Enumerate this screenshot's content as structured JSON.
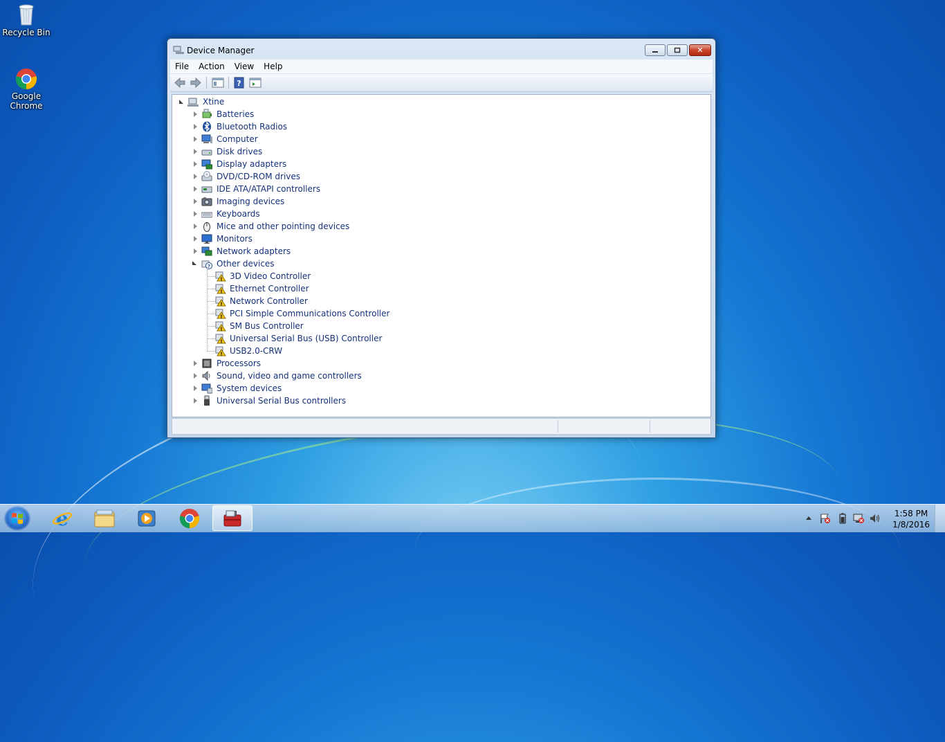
{
  "desktop": {
    "icons": [
      {
        "label": "Recycle Bin"
      },
      {
        "label": "Google Chrome"
      }
    ]
  },
  "window": {
    "title": "Device Manager",
    "menu": [
      "File",
      "Action",
      "View",
      "Help"
    ]
  },
  "tree": {
    "root": "Xtine",
    "categories": [
      {
        "label": "Batteries",
        "icon": "battery-icon",
        "expanded": false
      },
      {
        "label": "Bluetooth Radios",
        "icon": "bluetooth-icon",
        "expanded": false
      },
      {
        "label": "Computer",
        "icon": "computer-icon",
        "expanded": false
      },
      {
        "label": "Disk drives",
        "icon": "disk-drive-icon",
        "expanded": false
      },
      {
        "label": "Display adapters",
        "icon": "display-adapter-icon",
        "expanded": false
      },
      {
        "label": "DVD/CD-ROM drives",
        "icon": "dvd-drive-icon",
        "expanded": false
      },
      {
        "label": "IDE ATA/ATAPI controllers",
        "icon": "ide-controller-icon",
        "expanded": false
      },
      {
        "label": "Imaging devices",
        "icon": "camera-icon",
        "expanded": false
      },
      {
        "label": "Keyboards",
        "icon": "keyboard-icon",
        "expanded": false
      },
      {
        "label": "Mice and other pointing devices",
        "icon": "mouse-icon",
        "expanded": false
      },
      {
        "label": "Monitors",
        "icon": "monitor-icon",
        "expanded": false
      },
      {
        "label": "Network adapters",
        "icon": "network-adapter-icon",
        "expanded": false
      },
      {
        "label": "Other devices",
        "icon": "unknown-device-icon",
        "expanded": true,
        "children": [
          "3D Video Controller",
          "Ethernet Controller",
          "Network Controller",
          "PCI Simple Communications Controller",
          "SM Bus Controller",
          "Universal Serial Bus (USB) Controller",
          "USB2.0-CRW"
        ]
      },
      {
        "label": "Processors",
        "icon": "processor-icon",
        "expanded": false
      },
      {
        "label": "Sound, video and game controllers",
        "icon": "speaker-icon",
        "expanded": false
      },
      {
        "label": "System devices",
        "icon": "system-device-icon",
        "expanded": false
      },
      {
        "label": "Universal Serial Bus controllers",
        "icon": "usb-icon",
        "expanded": false
      }
    ]
  },
  "taskbar": {
    "clock_time": "1:58 PM",
    "clock_date": "1/8/2016"
  }
}
